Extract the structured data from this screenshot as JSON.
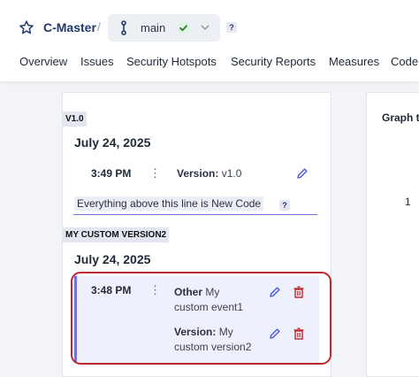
{
  "header": {
    "project_name": "C-Master",
    "separator": "/",
    "branch": {
      "name": "main",
      "status": "passed",
      "help": "?"
    },
    "icons": {
      "favorite": "star-icon",
      "branch": "branch-icon",
      "check": "check-icon",
      "dropdown": "chevron-down-icon"
    }
  },
  "tabs": [
    "Overview",
    "Issues",
    "Security Hotspots",
    "Security Reports",
    "Measures",
    "Code"
  ],
  "history": {
    "versions": [
      {
        "tag": "V1.0",
        "date": "July 24, 2025",
        "events": [
          {
            "time": "3:49 PM",
            "label": "Version:",
            "value": "v1.0"
          }
        ],
        "new_code_marker": "Everything above this line is New Code",
        "new_code_help": "?"
      },
      {
        "tag": "MY CUSTOM VERSION2",
        "date": "July 24, 2025",
        "events": [
          {
            "time": "3:48 PM",
            "label": "Other",
            "value_line1": "My",
            "value_line2": "custom event1"
          },
          {
            "label": "Version:",
            "value_line1": "My",
            "value_line2": "custom version2"
          }
        ]
      }
    ]
  },
  "graph": {
    "title": "Graph t",
    "value": "1"
  },
  "colors": {
    "brand": "#1f3a6b",
    "accent": "#6f76d8",
    "danger": "#c0262d",
    "success": "#2e7d32"
  }
}
